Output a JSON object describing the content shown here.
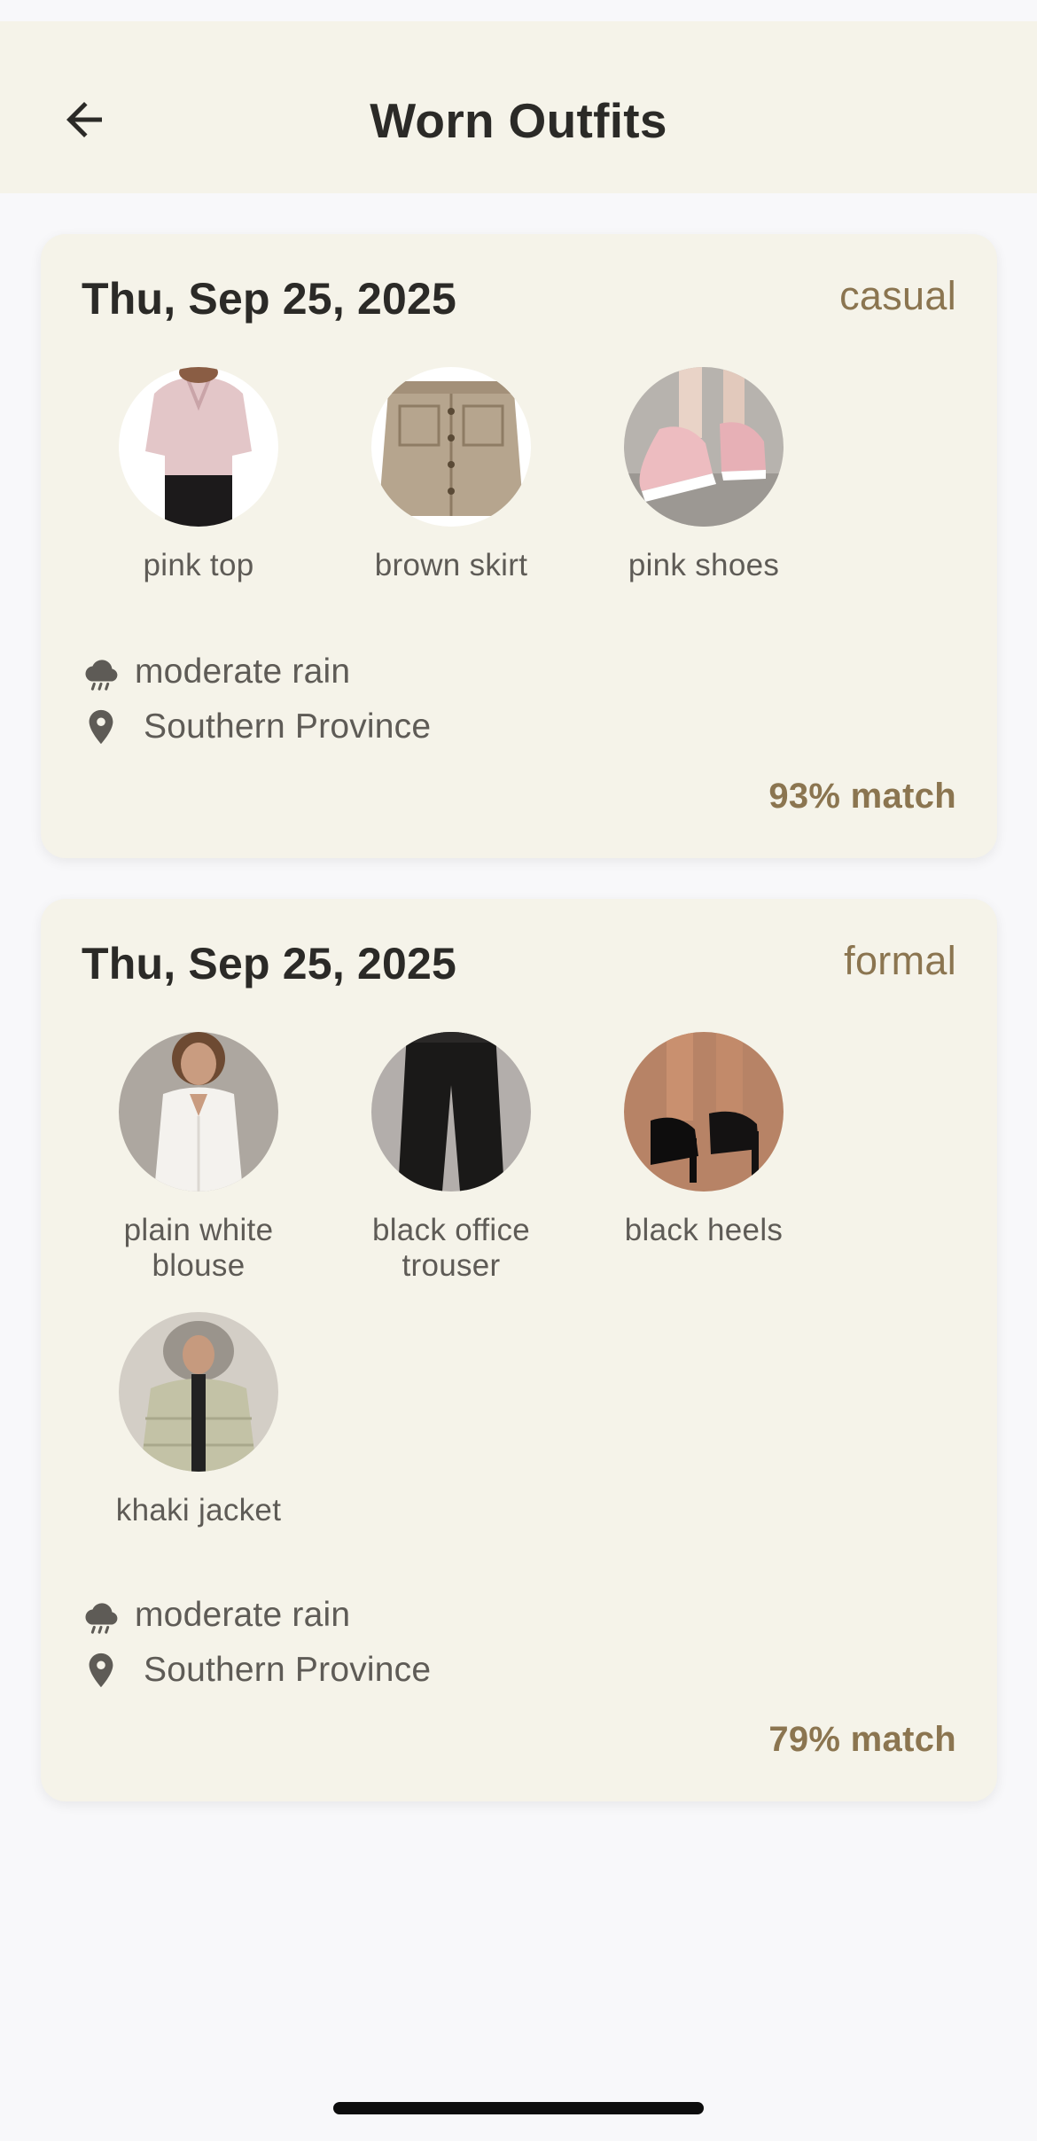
{
  "header": {
    "title": "Worn Outfits",
    "back_icon": "arrow-left-icon"
  },
  "outfits": [
    {
      "date": "Thu, Sep 25, 2025",
      "style": "casual",
      "items": [
        {
          "label": "pink top",
          "image": "pink-top-photo"
        },
        {
          "label": "brown skirt",
          "image": "brown-skirt-photo"
        },
        {
          "label": "pink shoes",
          "image": "pink-shoes-photo"
        }
      ],
      "weather": {
        "icon": "rain-cloud-icon",
        "text": "moderate rain"
      },
      "location": {
        "icon": "map-pin-icon",
        "text": "Southern Province"
      },
      "match": "93% match"
    },
    {
      "date": "Thu, Sep 25, 2025",
      "style": "formal",
      "items": [
        {
          "label": "plain white blouse",
          "image": "white-blouse-photo"
        },
        {
          "label": "black office trouser",
          "image": "black-trouser-photo"
        },
        {
          "label": "black heels",
          "image": "black-heels-photo"
        },
        {
          "label": "khaki jacket",
          "image": "khaki-jacket-photo"
        }
      ],
      "weather": {
        "icon": "rain-cloud-icon",
        "text": "moderate rain"
      },
      "location": {
        "icon": "map-pin-icon",
        "text": "Southern Province"
      },
      "match": "79% match"
    }
  ],
  "colors": {
    "background": "#f8f8fa",
    "surface": "#f5f3e9",
    "accent": "#8b7550",
    "text_primary": "#2b2a27",
    "text_secondary": "#5e5b56"
  }
}
